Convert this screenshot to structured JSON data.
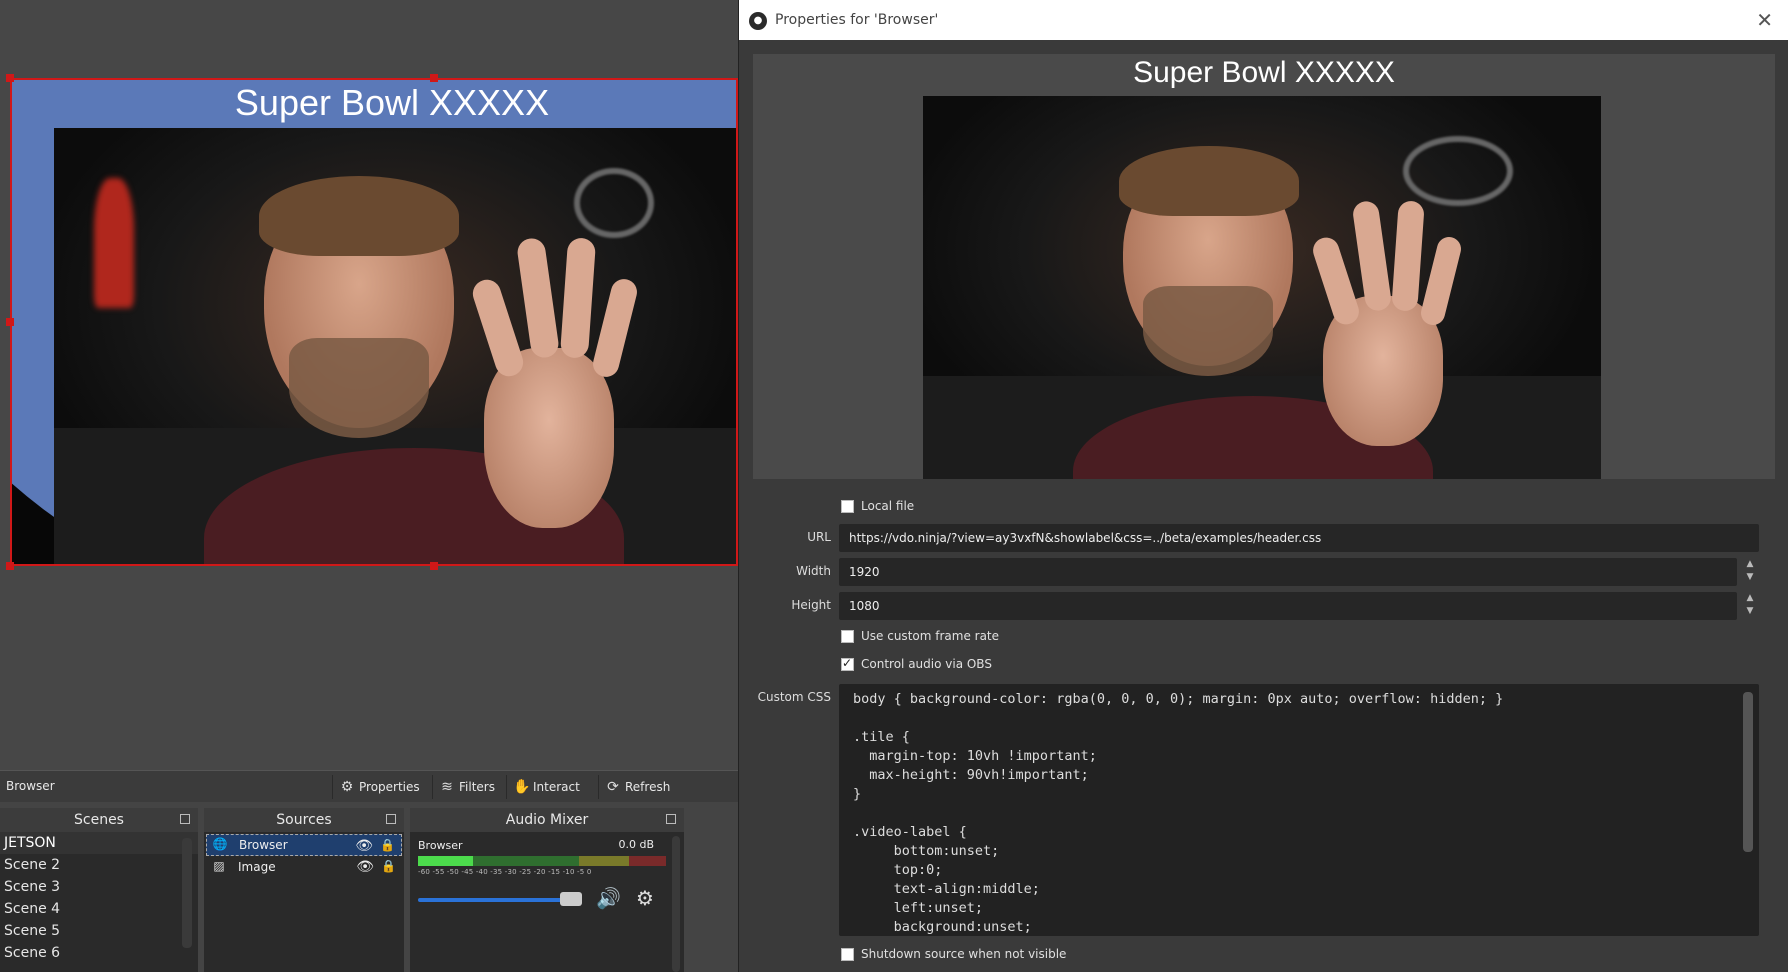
{
  "preview": {
    "overlay_title": "Super Bowl XXXXX"
  },
  "source_toolbar": {
    "selected_source": "Browser",
    "buttons": [
      {
        "icon": "gear-icon",
        "label": "Properties"
      },
      {
        "icon": "filter-icon",
        "label": "Filters"
      },
      {
        "icon": "hand-icon",
        "label": "Interact"
      },
      {
        "icon": "refresh-icon",
        "label": "Refresh"
      }
    ]
  },
  "scenes": {
    "title": "Scenes",
    "items": [
      "JETSON",
      "Scene 2",
      "Scene 3",
      "Scene 4",
      "Scene 5",
      "Scene 6"
    ]
  },
  "sources": {
    "title": "Sources",
    "items": [
      {
        "name": "Browser",
        "icon": "globe-icon"
      },
      {
        "name": "Image",
        "icon": "image-icon"
      }
    ]
  },
  "audio_mixer": {
    "title": "Audio Mixer",
    "channel_name": "Browser",
    "level": "0.0 dB",
    "ticks": "-60 -55 -50 -45 -40 -35 -30 -25 -20 -15 -10 -5 0"
  },
  "dialog": {
    "title": "Properties for 'Browser'",
    "preview_title": "Super Bowl XXXXX",
    "local_file_label": "Local file",
    "local_file_checked": false,
    "url_label": "URL",
    "url_value": "https://vdo.ninja/?view=ay3vxfN&showlabel&css=../beta/examples/header.css",
    "width_label": "Width",
    "width_value": "1920",
    "height_label": "Height",
    "height_value": "1080",
    "custom_frame_rate_label": "Use custom frame rate",
    "custom_frame_rate_checked": false,
    "control_audio_label": "Control audio via OBS",
    "control_audio_checked": true,
    "custom_css_label": "Custom CSS",
    "custom_css": "body { background-color: rgba(0, 0, 0, 0); margin: 0px auto; overflow: hidden; }\n\n.tile {\n  margin-top: 10vh !important;\n  max-height: 90vh!important;\n}\n\n.video-label {\n     bottom:unset;\n     top:0;\n     text-align:middle;\n     left:unset;\n     background:unset;",
    "shutdown_label": "Shutdown source when not visible",
    "shutdown_checked": false
  },
  "colors": {
    "selection_outline": "#d01818",
    "overlay_blue": "#5b79b8",
    "volume_slider": "#2a72d8"
  }
}
